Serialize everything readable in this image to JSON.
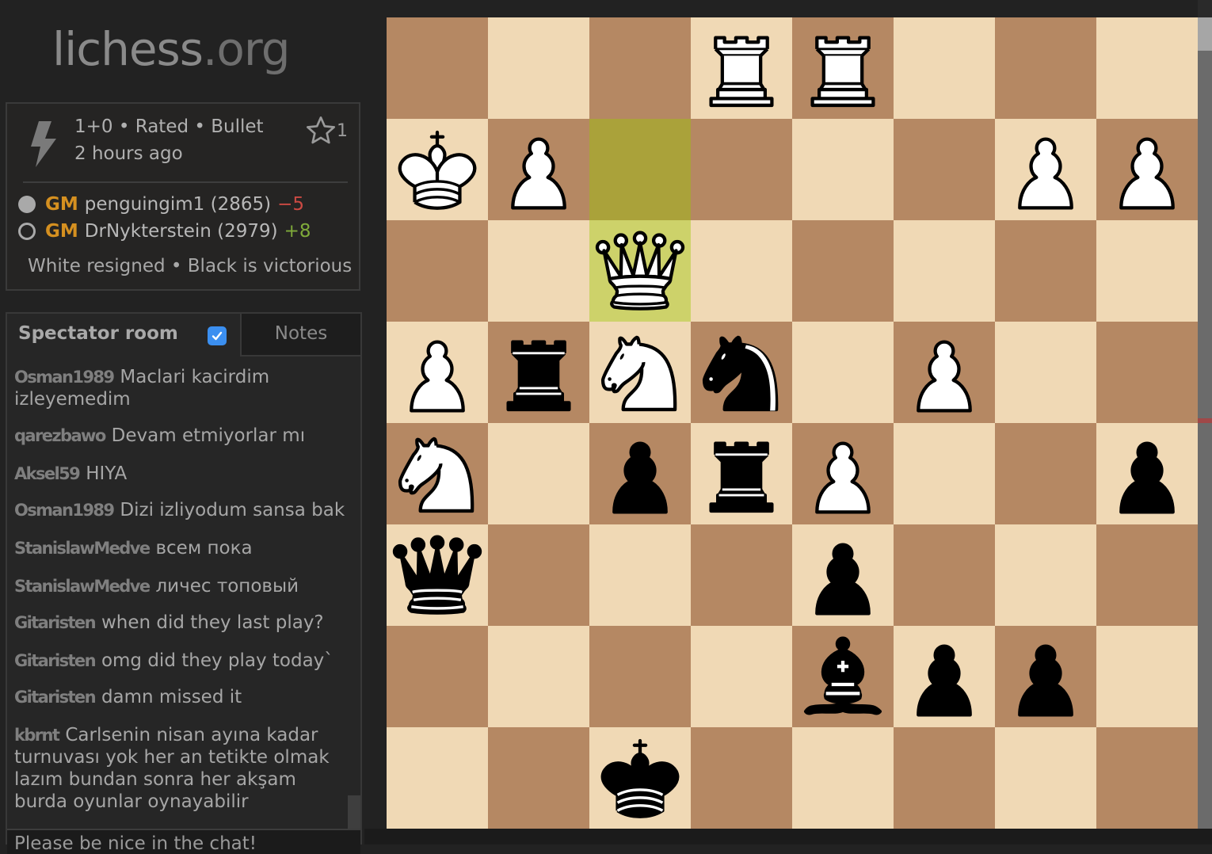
{
  "site": {
    "logo_main": "lichess",
    "logo_tld": ".org"
  },
  "game": {
    "speed_icon": "lightning-bolt-icon",
    "meta": "1+0 • Rated • Bullet",
    "time_ago": "2 hours ago",
    "bookmark_icon": "star-icon",
    "bookmark_count": "1",
    "players": [
      {
        "color": "white",
        "title": "GM",
        "name": "penguingim1",
        "rating": "(2865)",
        "rating_diff": "−5",
        "diff_sign": "neg"
      },
      {
        "color": "black",
        "title": "GM",
        "name": "DrNykterstein",
        "rating": "(2979)",
        "rating_diff": "+8",
        "diff_sign": "pos"
      }
    ],
    "result": "White resigned • Black is victorious"
  },
  "chat": {
    "tab_spectator": "Spectator room",
    "spectator_enabled": true,
    "tab_notes": "Notes",
    "messages": [
      {
        "user": "Osman1989",
        "text": "Maclari kacirdim izleyemedim"
      },
      {
        "user": "qarezbawo",
        "text": "Devam etmiyorlar mı"
      },
      {
        "user": "Aksel59",
        "text": "HIYA"
      },
      {
        "user": "Osman1989",
        "text": "Dizi izliyodum sansa bak"
      },
      {
        "user": "StanislawMedve",
        "text": "всем пока"
      },
      {
        "user": "StanislawMedve",
        "text": "личес топовый"
      },
      {
        "user": "Gitaristen",
        "text": "when did they last play?"
      },
      {
        "user": "Gitaristen",
        "text": "omg did they play today`"
      },
      {
        "user": "Gitaristen",
        "text": "damn missed it"
      },
      {
        "user": "kbrnt",
        "text": "Carlsenin nisan ayına kadar turnuvası yok her an tetikte olmak lazım bundan sonra her akşam burda oyunlar oynayabilir"
      }
    ],
    "input_placeholder": "Please be nice in the chat!"
  },
  "board": {
    "orientation": "white",
    "colors": {
      "light": "#f0d9b5",
      "dark": "#b58863",
      "last_move_from": "#aaa23a",
      "last_move_to": "#cdd26a"
    },
    "last_move": {
      "from": "c7",
      "to": "c6"
    },
    "pieces": [
      {
        "square": "d8",
        "color": "white",
        "type": "rook"
      },
      {
        "square": "e8",
        "color": "white",
        "type": "rook"
      },
      {
        "square": "a7",
        "color": "white",
        "type": "king"
      },
      {
        "square": "b7",
        "color": "white",
        "type": "pawn"
      },
      {
        "square": "g7",
        "color": "white",
        "type": "pawn"
      },
      {
        "square": "h7",
        "color": "white",
        "type": "pawn"
      },
      {
        "square": "c6",
        "color": "white",
        "type": "queen"
      },
      {
        "square": "a5",
        "color": "white",
        "type": "pawn"
      },
      {
        "square": "b5",
        "color": "black",
        "type": "rook"
      },
      {
        "square": "c5",
        "color": "white",
        "type": "knight"
      },
      {
        "square": "d5",
        "color": "black",
        "type": "knight"
      },
      {
        "square": "f5",
        "color": "white",
        "type": "pawn"
      },
      {
        "square": "a4",
        "color": "white",
        "type": "knight"
      },
      {
        "square": "c4",
        "color": "black",
        "type": "pawn"
      },
      {
        "square": "d4",
        "color": "black",
        "type": "rook"
      },
      {
        "square": "e4",
        "color": "white",
        "type": "pawn"
      },
      {
        "square": "h4",
        "color": "black",
        "type": "pawn"
      },
      {
        "square": "a3",
        "color": "black",
        "type": "queen"
      },
      {
        "square": "e3",
        "color": "black",
        "type": "pawn"
      },
      {
        "square": "e2",
        "color": "black",
        "type": "bishop"
      },
      {
        "square": "f2",
        "color": "black",
        "type": "pawn"
      },
      {
        "square": "g2",
        "color": "black",
        "type": "pawn"
      },
      {
        "square": "c1",
        "color": "black",
        "type": "king"
      }
    ]
  }
}
